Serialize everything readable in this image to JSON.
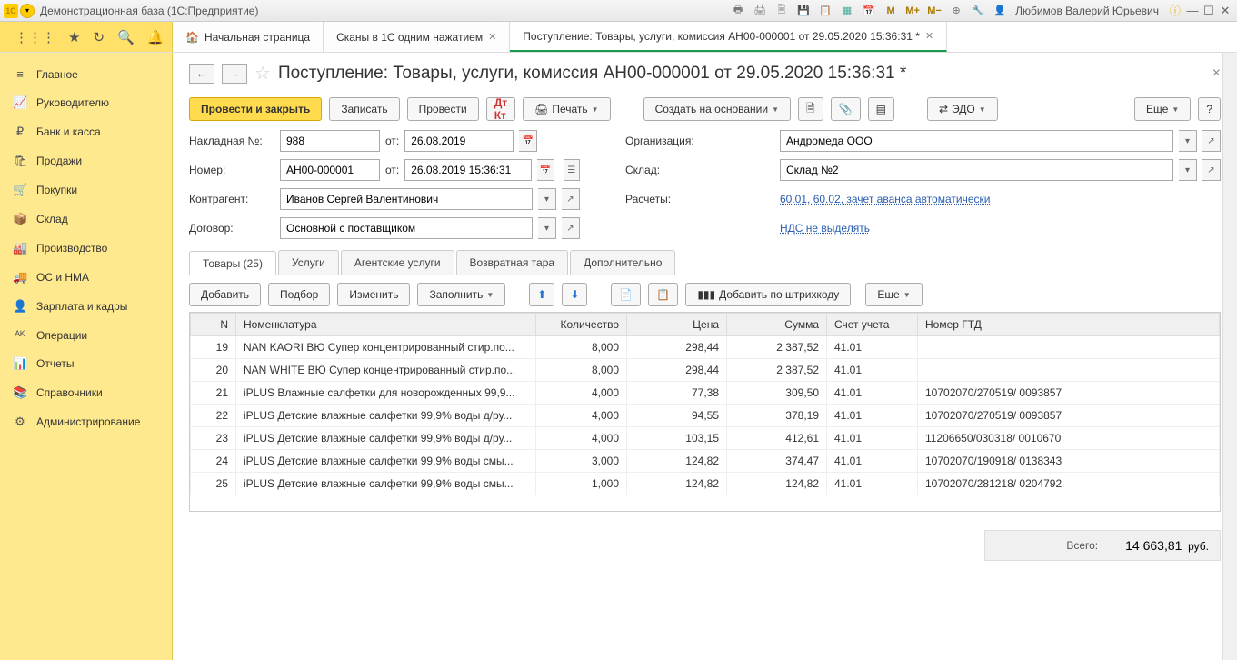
{
  "titlebar": {
    "app_title": "Демонстрационная база  (1С:Предприятие)",
    "user": "Любимов Валерий Юрьевич"
  },
  "top_tabs": {
    "home": "Начальная страница",
    "scan": "Сканы в 1С одним нажатием",
    "doc": "Поступление: Товары, услуги, комиссия АН00-000001 от 29.05.2020 15:36:31 *"
  },
  "sidebar": {
    "items": [
      {
        "icon": "≡",
        "label": "Главное"
      },
      {
        "icon": "📈",
        "label": "Руководителю"
      },
      {
        "icon": "₽",
        "label": "Банк и касса"
      },
      {
        "icon": "🛍",
        "label": "Продажи"
      },
      {
        "icon": "🛒",
        "label": "Покупки"
      },
      {
        "icon": "📦",
        "label": "Склад"
      },
      {
        "icon": "🏭",
        "label": "Производство"
      },
      {
        "icon": "🚚",
        "label": "ОС и НМА"
      },
      {
        "icon": "👤",
        "label": "Зарплата и кадры"
      },
      {
        "icon": "ᴬᴷ",
        "label": "Операции"
      },
      {
        "icon": "📊",
        "label": "Отчеты"
      },
      {
        "icon": "📚",
        "label": "Справочники"
      },
      {
        "icon": "⚙",
        "label": "Администрирование"
      }
    ]
  },
  "header": {
    "title": "Поступление: Товары, услуги, комиссия АН00-000001 от 29.05.2020 15:36:31 *"
  },
  "toolbar": {
    "post_close": "Провести и закрыть",
    "save": "Записать",
    "post": "Провести",
    "print": "Печать",
    "create_based": "Создать на основании",
    "edo": "ЭДО",
    "more": "Еще"
  },
  "form": {
    "invoice_lbl": "Накладная  №:",
    "invoice_no": "988",
    "from_lbl": "от:",
    "invoice_date": "26.08.2019",
    "org_lbl": "Организация:",
    "org_val": "Андромеда ООО",
    "num_lbl": "Номер:",
    "num_val": "АН00-000001",
    "num_date": "26.08.2019 15:36:31",
    "warehouse_lbl": "Склад:",
    "warehouse_val": "Склад №2",
    "counterparty_lbl": "Контрагент:",
    "counterparty_val": "Иванов Сергей Валентинович",
    "calc_lbl": "Расчеты:",
    "calc_link": "60.01, 60.02, зачет аванса автоматически",
    "contract_lbl": "Договор:",
    "contract_val": "Основной с поставщиком",
    "vat_link": "НДС не выделять"
  },
  "subtabs": {
    "goods": "Товары (25)",
    "services": "Услуги",
    "agent": "Агентские услуги",
    "returnable": "Возвратная тара",
    "additional": "Дополнительно"
  },
  "tbl_toolbar": {
    "add": "Добавить",
    "pick": "Подбор",
    "edit": "Изменить",
    "fill": "Заполнить",
    "barcode": "Добавить по штрихкоду",
    "more": "Еще"
  },
  "table": {
    "headers": {
      "n": "N",
      "nom": "Номенклатура",
      "qty": "Количество",
      "price": "Цена",
      "sum": "Сумма",
      "acc": "Счет учета",
      "gtd": "Номер ГТД"
    },
    "rows": [
      {
        "n": "19",
        "nom": "NAN KAORI BЮ Супер концентрированный стир.по...",
        "qty": "8,000",
        "price": "298,44",
        "sum": "2 387,52",
        "acc": "41.01",
        "gtd": ""
      },
      {
        "n": "20",
        "nom": "NAN WHITE BЮ Супер концентрированный стир.по...",
        "qty": "8,000",
        "price": "298,44",
        "sum": "2 387,52",
        "acc": "41.01",
        "gtd": ""
      },
      {
        "n": "21",
        "nom": "iPLUS Влажные салфетки для новорожденных 99,9...",
        "qty": "4,000",
        "price": "77,38",
        "sum": "309,50",
        "acc": "41.01",
        "gtd": "10702070/270519/ 0093857"
      },
      {
        "n": "22",
        "nom": "iPLUS Детские влажные салфетки 99,9% воды д/ру...",
        "qty": "4,000",
        "price": "94,55",
        "sum": "378,19",
        "acc": "41.01",
        "gtd": "10702070/270519/ 0093857"
      },
      {
        "n": "23",
        "nom": "iPLUS Детские влажные салфетки 99,9% воды д/ру...",
        "qty": "4,000",
        "price": "103,15",
        "sum": "412,61",
        "acc": "41.01",
        "gtd": "11206650/030318/ 0010670"
      },
      {
        "n": "24",
        "nom": "iPLUS Детские влажные салфетки 99,9% воды смы...",
        "qty": "3,000",
        "price": "124,82",
        "sum": "374,47",
        "acc": "41.01",
        "gtd": "10702070/190918/ 0138343"
      },
      {
        "n": "25",
        "nom": "iPLUS Детские влажные салфетки 99,9% воды смы...",
        "qty": "1,000",
        "price": "124,82",
        "sum": "124,82",
        "acc": "41.01",
        "gtd": "10702070/281218/ 0204792"
      }
    ]
  },
  "footer": {
    "total_lbl": "Всего:",
    "total_val": "14 663,81",
    "currency": "руб."
  }
}
